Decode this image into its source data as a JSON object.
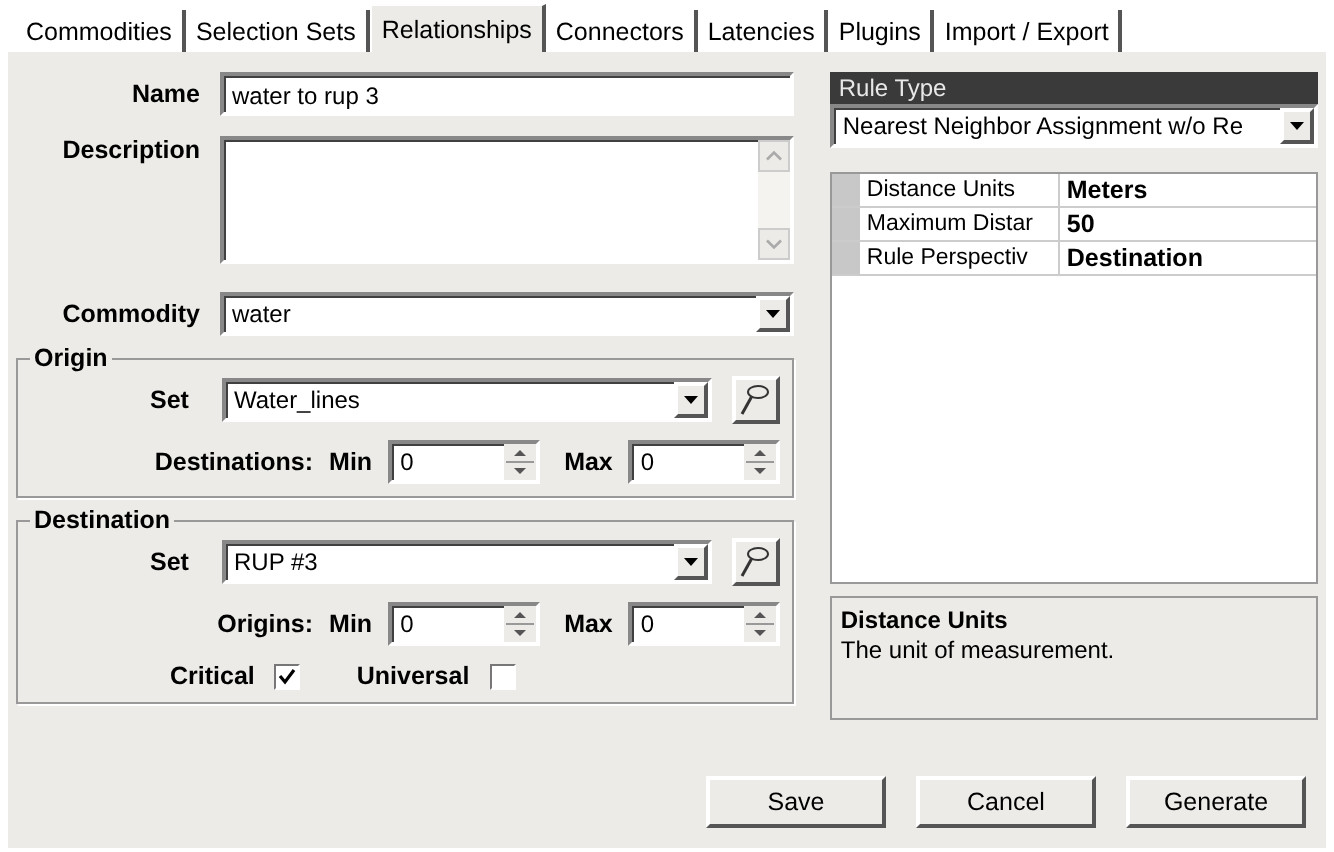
{
  "tabs": [
    {
      "label": "Commodities",
      "selected": false
    },
    {
      "label": "Selection Sets",
      "selected": false
    },
    {
      "label": "Relationships",
      "selected": true
    },
    {
      "label": "Connectors",
      "selected": false
    },
    {
      "label": "Latencies",
      "selected": false
    },
    {
      "label": "Plugins",
      "selected": false
    },
    {
      "label": "Import / Export",
      "selected": false
    }
  ],
  "name": {
    "label": "Name",
    "value": "water to rup 3"
  },
  "description": {
    "label": "Description"
  },
  "commodity": {
    "label": "Commodity",
    "value": "water"
  },
  "origin": {
    "title": "Origin",
    "set_label": "Set",
    "set_value": "Water_lines",
    "count_label": "Destinations:",
    "min_label": "Min",
    "min_value": "0",
    "max_label": "Max",
    "max_value": "0"
  },
  "destination": {
    "title": "Destination",
    "set_label": "Set",
    "set_value": "RUP #3",
    "count_label": "Origins:",
    "min_label": "Min",
    "min_value": "0",
    "max_label": "Max",
    "max_value": "0",
    "checks": [
      {
        "label": "Critical",
        "checked": true
      },
      {
        "label": "Universal",
        "checked": false
      }
    ]
  },
  "rule_type": {
    "title": "Rule Type",
    "value": "Nearest Neighbor Assignment w/o Re"
  },
  "properties": [
    {
      "name": "Distance Units",
      "value": "Meters"
    },
    {
      "name": "Maximum Distar",
      "value": "50"
    },
    {
      "name": "Rule Perspectiv",
      "value": "Destination"
    }
  ],
  "help": {
    "title": "Distance Units",
    "text": "The unit of measurement."
  },
  "buttons": [
    "Save",
    "Cancel",
    "Generate"
  ]
}
